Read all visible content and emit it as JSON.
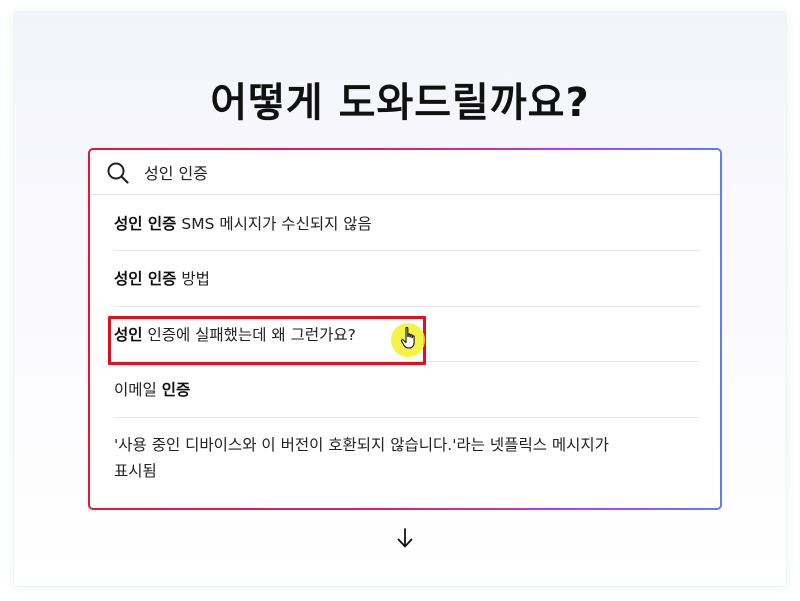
{
  "heading": "어떻게 도와드릴까요?",
  "search": {
    "value": "성인 인증",
    "icon": "search-icon"
  },
  "suggestions": [
    {
      "bold": "성인 인증",
      "rest": " SMS 메시지가 수신되지 않음"
    },
    {
      "bold": "성인 인증",
      "rest": " 방법"
    },
    {
      "bold": "성인",
      "rest": " 인증에 실패했는데 왜 그런가요?"
    },
    {
      "before": "이메일 ",
      "bold": "인증"
    },
    {
      "line1": "'사용 중인 디바이스와 이 버전이 호환되지 않습니다.'라는 넷플릭스 메시지가",
      "line2": "표시됨"
    }
  ],
  "colors": {
    "highlight_box": "#e0101e",
    "cursor_halo": "#f4f028",
    "border_gradient_start": "#e5163a",
    "border_gradient_end": "#5f7ef5"
  },
  "icons": {
    "cursor": "hand-pointer-icon",
    "scroll": "arrow-down-icon"
  }
}
